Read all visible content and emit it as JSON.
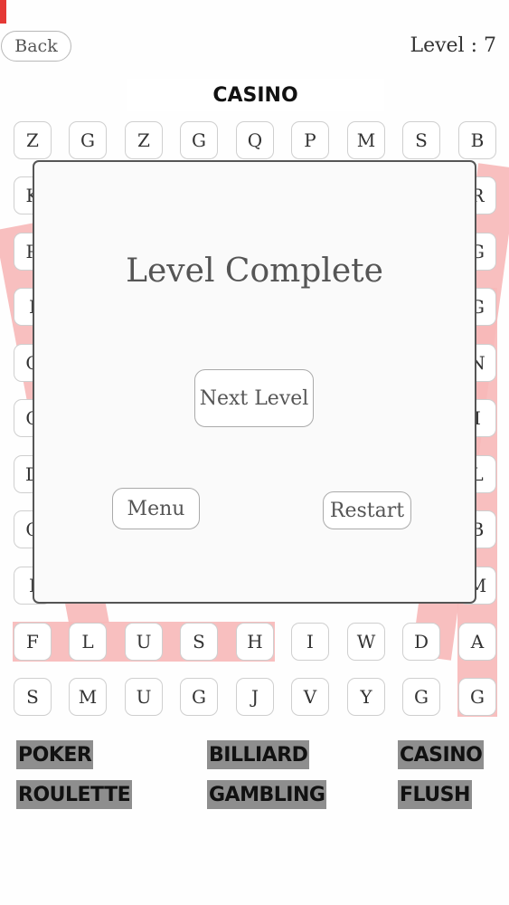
{
  "header": {
    "back_label": "Back",
    "level_label": "Level : 7",
    "category": "CASINO"
  },
  "grid": {
    "rows": [
      [
        "Z",
        "G",
        "Z",
        "G",
        "Q",
        "P",
        "M",
        "S",
        "B"
      ],
      [
        "K",
        "",
        "",
        "",
        "",
        "",
        "",
        "",
        "R"
      ],
      [
        "R",
        "",
        "",
        "",
        "",
        "",
        "",
        "",
        "G"
      ],
      [
        "I",
        "",
        "",
        "",
        "",
        "",
        "",
        "",
        "G"
      ],
      [
        "C",
        "",
        "",
        "",
        "",
        "",
        "",
        "",
        "N"
      ],
      [
        "C",
        "",
        "",
        "",
        "",
        "",
        "",
        "",
        "I"
      ],
      [
        "D",
        "",
        "",
        "",
        "",
        "",
        "",
        "",
        "L"
      ],
      [
        "C",
        "",
        "",
        "",
        "",
        "",
        "",
        "",
        "B"
      ],
      [
        "I",
        "",
        "",
        "",
        "",
        "",
        "",
        "",
        "M"
      ],
      [
        "F",
        "L",
        "U",
        "S",
        "H",
        "I",
        "W",
        "D",
        "A"
      ],
      [
        "S",
        "M",
        "U",
        "G",
        "J",
        "V",
        "Y",
        "G",
        "G"
      ]
    ],
    "highlight_color": "#f7b8b8"
  },
  "modal": {
    "title": "Level Complete",
    "next_label": "Next Level",
    "menu_label": "Menu",
    "restart_label": "Restart"
  },
  "words": [
    "POKER",
    "BILLIARD",
    "CASINO",
    "ROULETTE",
    "GAMBLING",
    "FLUSH"
  ]
}
